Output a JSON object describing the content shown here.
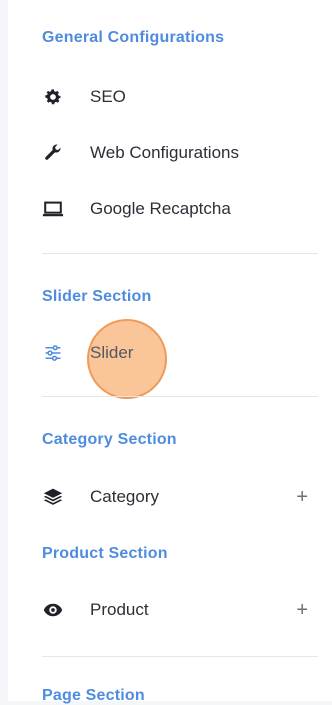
{
  "sections": [
    {
      "title": "General Configurations"
    },
    {
      "title": "Slider Section"
    },
    {
      "title": "Category Section"
    },
    {
      "title": "Product Section"
    },
    {
      "title": "Page Section"
    }
  ],
  "items": {
    "seo": {
      "label": "SEO",
      "icon": "gear-icon"
    },
    "web_config": {
      "label": "Web Configurations",
      "icon": "wrench-icon"
    },
    "recaptcha": {
      "label": "Google Recaptcha",
      "icon": "laptop-icon"
    },
    "slider": {
      "label": "Slider",
      "icon": "sliders-icon"
    },
    "category": {
      "label": "Category",
      "icon": "layers-icon",
      "expand": "+"
    },
    "product": {
      "label": "Product",
      "icon": "eye-icon",
      "expand": "+"
    }
  },
  "colors": {
    "accent": "#4f8ce0",
    "highlight": "#f9b278",
    "text": "#2b2f36"
  }
}
